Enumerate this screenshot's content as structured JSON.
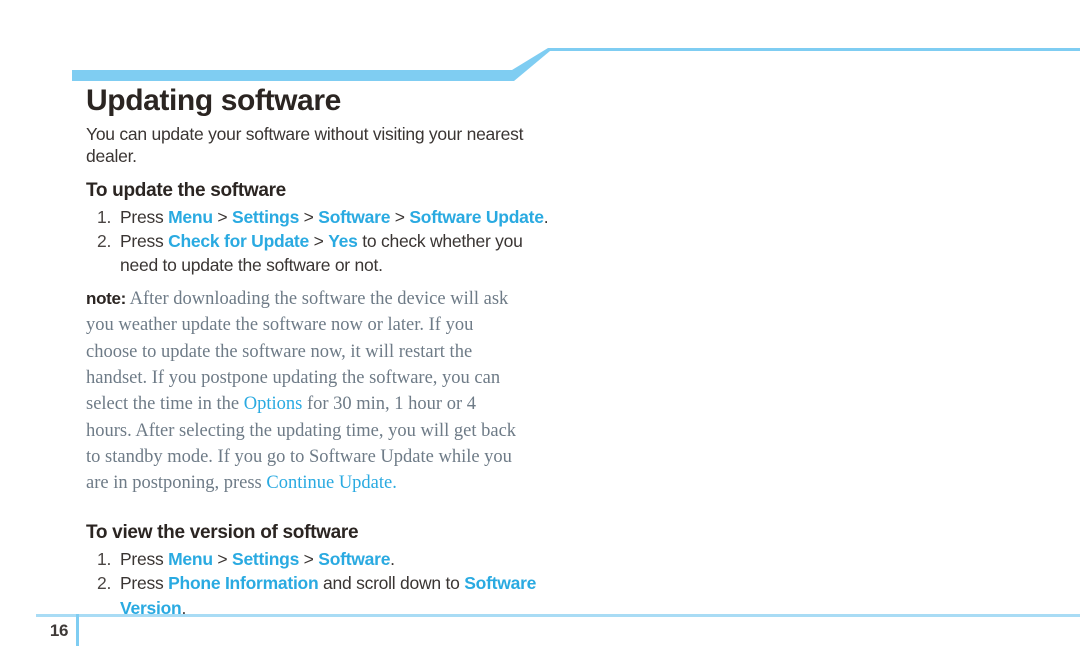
{
  "document": {
    "title": "Updating software",
    "intro": "You can update your software without visiting your nearest dealer.",
    "page_number": "16"
  },
  "colors": {
    "accent_cyan": "#2aaae1",
    "rule_blue": "#7fcdf2",
    "footer_line": "#a9dcf5",
    "heading_dark": "#2b2522",
    "body_dark": "#3a3533",
    "note_gray": "#6e7b87"
  },
  "sections": [
    {
      "heading": "To update the software",
      "steps": [
        {
          "number": "1.",
          "parts": [
            {
              "text": "Press ",
              "style": "plain"
            },
            {
              "text": "Menu",
              "style": "highlight"
            },
            {
              "text": " > ",
              "style": "separator"
            },
            {
              "text": "Settings",
              "style": "highlight"
            },
            {
              "text": " > ",
              "style": "separator"
            },
            {
              "text": "Software",
              "style": "highlight"
            },
            {
              "text": " > ",
              "style": "separator"
            },
            {
              "text": "Software Update",
              "style": "highlight"
            },
            {
              "text": ".",
              "style": "plain"
            }
          ]
        },
        {
          "number": "2.",
          "parts": [
            {
              "text": "Press ",
              "style": "plain"
            },
            {
              "text": "Check for Update",
              "style": "highlight"
            },
            {
              "text": " > ",
              "style": "separator"
            },
            {
              "text": "Yes",
              "style": "highlight"
            },
            {
              "text": " to check whether you need to update the software or not.",
              "style": "plain"
            }
          ]
        }
      ]
    },
    {
      "heading": "To view the version of software",
      "steps": [
        {
          "number": "1.",
          "parts": [
            {
              "text": "Press ",
              "style": "plain"
            },
            {
              "text": "Menu",
              "style": "highlight"
            },
            {
              "text": " > ",
              "style": "separator"
            },
            {
              "text": "Settings",
              "style": "highlight"
            },
            {
              "text": " > ",
              "style": "separator"
            },
            {
              "text": "Software",
              "style": "highlight"
            },
            {
              "text": ".",
              "style": "plain"
            }
          ]
        },
        {
          "number": "2.",
          "parts": [
            {
              "text": "Press ",
              "style": "plain"
            },
            {
              "text": "Phone Information",
              "style": "highlight"
            },
            {
              "text": " and scroll down to ",
              "style": "plain"
            },
            {
              "text": "Software Version",
              "style": "highlight"
            },
            {
              "text": ".",
              "style": "plain"
            }
          ]
        }
      ]
    }
  ],
  "note": {
    "label": "note:",
    "parts": [
      {
        "text": " After downloading the software the device will ask you weather update the software now or later. If you choose to update the software now, it will restart the handset. If you postpone updating the software, you can select the time in the ",
        "style": "plain"
      },
      {
        "text": "Options",
        "style": "highlight"
      },
      {
        "text": " for 30 min, 1 hour or 4 hours. After selecting the updating time, you will get back to standby mode. If you go to Software Update while you are in postponing, press ",
        "style": "plain"
      },
      {
        "text": "Continue Update.",
        "style": "highlight"
      }
    ]
  }
}
